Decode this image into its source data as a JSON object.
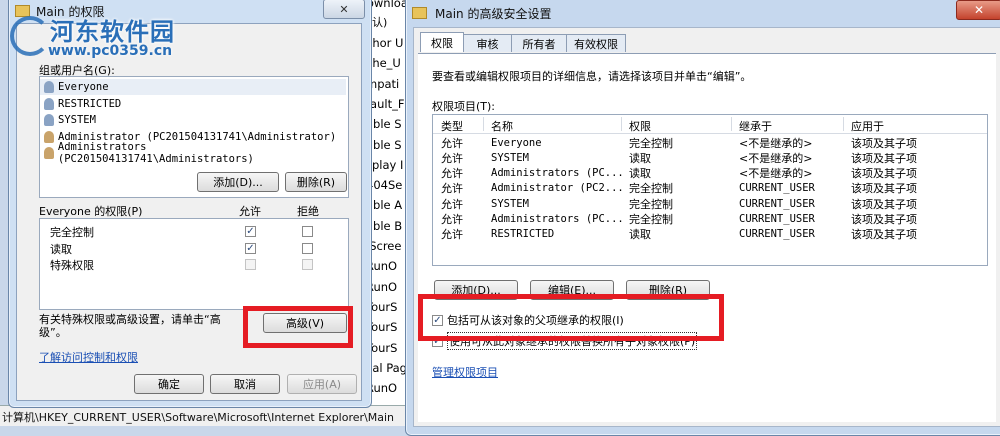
{
  "background_explorer": {
    "tree_items": [
      "Download",
      "chor U",
      "che_U",
      "mpati",
      "fault_F",
      "able S",
      "able S",
      "splay I",
      "404Se",
      "able A",
      "able B",
      "lScree",
      "RunO",
      "RunO",
      "TourS",
      "TourS",
      "TourS",
      "cal Pag",
      "RunO"
    ],
    "partial_text": "认)",
    "status_path": "计算机\\HKEY_CURRENT_USER\\Software\\Microsoft\\Internet Explorer\\Main"
  },
  "watermark": {
    "brand": "河东软件园",
    "url": "www.pc0359.cn"
  },
  "perm_window": {
    "title": "Main 的权限",
    "close_glyph": "✕",
    "group_label": "组或用户名(G):",
    "users": [
      "Everyone",
      "RESTRICTED",
      "SYSTEM",
      "Administrator (PC201504131741\\Administrator)",
      "Administrators (PC201504131741\\Administrators)"
    ],
    "add_button": "添加(D)...",
    "remove_button": "删除(R)",
    "perm_header": "Everyone 的权限(P)",
    "allow_header": "允许",
    "deny_header": "拒绝",
    "permissions": [
      {
        "name": "完全控制",
        "allow": true,
        "deny": false,
        "disabled": false
      },
      {
        "name": "读取",
        "allow": true,
        "deny": false,
        "disabled": false
      },
      {
        "name": "特殊权限",
        "allow": false,
        "deny": false,
        "disabled": true
      }
    ],
    "special_text_1": "有关特殊权限或高级设置，请单击“高",
    "special_text_2": "级”。",
    "advanced_button": "高级(V)",
    "learn_link": "了解访问控制和权限",
    "ok_button": "确定",
    "cancel_button": "取消",
    "apply_button": "应用(A)"
  },
  "adv_window": {
    "title": "Main 的高级安全设置",
    "tabs": [
      "权限",
      "审核",
      "所有者",
      "有效权限"
    ],
    "instruction": "要查看或编辑权限项目的详细信息，请选择该项目并单击“编辑”。",
    "entries_label": "权限项目(T):",
    "columns": [
      "类型",
      "名称",
      "权限",
      "继承于",
      "应用于"
    ],
    "rows": [
      [
        "允许",
        "Everyone",
        "完全控制",
        "<不是继承的>",
        "该项及其子项"
      ],
      [
        "允许",
        "SYSTEM",
        "读取",
        "<不是继承的>",
        "该项及其子项"
      ],
      [
        "允许",
        "Administrators (PC...",
        "读取",
        "<不是继承的>",
        "该项及其子项"
      ],
      [
        "允许",
        "Administrator (PC2...",
        "完全控制",
        "CURRENT_USER",
        "该项及其子项"
      ],
      [
        "允许",
        "SYSTEM",
        "完全控制",
        "CURRENT_USER",
        "该项及其子项"
      ],
      [
        "允许",
        "Administrators (PC...",
        "完全控制",
        "CURRENT_USER",
        "该项及其子项"
      ],
      [
        "允许",
        "RESTRICTED",
        "读取",
        "CURRENT_USER",
        "该项及其子项"
      ]
    ],
    "add_button": "添加(D)...",
    "edit_button": "编辑(E)...",
    "remove_button": "删除(R)",
    "inherit_checkbox": "包括可从该对象的父项继承的权限(I)",
    "replace_checkbox": "使用可从此对象继承的权限替换所有子对象权限(P)",
    "manage_link": "管理权限项目"
  },
  "colors": {
    "highlight": "#e51c23",
    "link": "#1a4fb4",
    "watermark": "#2a6fb8"
  }
}
